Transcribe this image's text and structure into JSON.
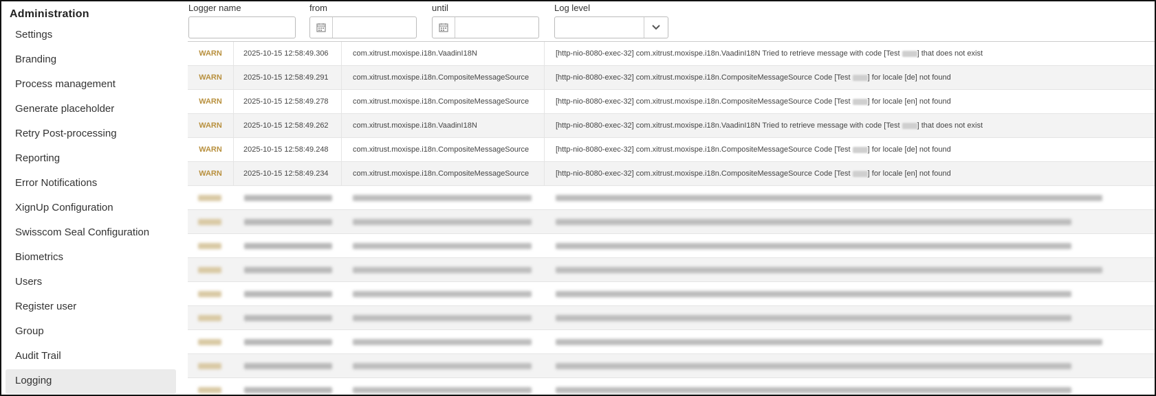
{
  "sidebar": {
    "title": "Administration",
    "items": [
      {
        "label": "Settings"
      },
      {
        "label": "Branding"
      },
      {
        "label": "Process management"
      },
      {
        "label": "Generate placeholder"
      },
      {
        "label": "Retry Post-processing"
      },
      {
        "label": "Reporting"
      },
      {
        "label": "Error Notifications"
      },
      {
        "label": "XignUp Configuration"
      },
      {
        "label": "Swisscom Seal Configuration"
      },
      {
        "label": "Biometrics"
      },
      {
        "label": "Users"
      },
      {
        "label": "Register user"
      },
      {
        "label": "Group"
      },
      {
        "label": "Audit Trail"
      },
      {
        "label": "Logging"
      }
    ],
    "active": "Logging"
  },
  "filters": {
    "logger_label": "Logger name",
    "from_label": "from",
    "until_label": "until",
    "level_label": "Log level",
    "logger_value": "",
    "from_value": "",
    "until_value": "",
    "level_value": ""
  },
  "log_rows": [
    {
      "level": "WARN",
      "time": "2025-10-15 12:58:49.306",
      "logger": "com.xitrust.moxispe.i18n.VaadinI18N",
      "msg_pre": "[http-nio-8080-exec-32] com.xitrust.moxispe.i18n.VaadinI18N Tried to retrieve message with code [Test",
      "msg_post": "] that does not exist"
    },
    {
      "level": "WARN",
      "time": "2025-10-15 12:58:49.291",
      "logger": "com.xitrust.moxispe.i18n.CompositeMessageSource",
      "msg_pre": "[http-nio-8080-exec-32] com.xitrust.moxispe.i18n.CompositeMessageSource Code [Test",
      "msg_post": "] for locale [de] not found"
    },
    {
      "level": "WARN",
      "time": "2025-10-15 12:58:49.278",
      "logger": "com.xitrust.moxispe.i18n.CompositeMessageSource",
      "msg_pre": "[http-nio-8080-exec-32] com.xitrust.moxispe.i18n.CompositeMessageSource Code [Test",
      "msg_post": "] for locale [en] not found"
    },
    {
      "level": "WARN",
      "time": "2025-10-15 12:58:49.262",
      "logger": "com.xitrust.moxispe.i18n.VaadinI18N",
      "msg_pre": "[http-nio-8080-exec-32] com.xitrust.moxispe.i18n.VaadinI18N Tried to retrieve message with code [Test",
      "msg_post": "] that does not exist"
    },
    {
      "level": "WARN",
      "time": "2025-10-15 12:58:49.248",
      "logger": "com.xitrust.moxispe.i18n.CompositeMessageSource",
      "msg_pre": "[http-nio-8080-exec-32] com.xitrust.moxispe.i18n.CompositeMessageSource Code [Test",
      "msg_post": "] for locale [de] not found"
    },
    {
      "level": "WARN",
      "time": "2025-10-15 12:58:49.234",
      "logger": "com.xitrust.moxispe.i18n.CompositeMessageSource",
      "msg_pre": "[http-nio-8080-exec-32] com.xitrust.moxispe.i18n.CompositeMessageSource Code [Test",
      "msg_post": "] for locale [en] not found"
    }
  ],
  "blurred_row_count": 9,
  "colors": {
    "warn": "#b8903e",
    "row_alt": "#f3f3f3",
    "active_item": "#ebebeb"
  }
}
